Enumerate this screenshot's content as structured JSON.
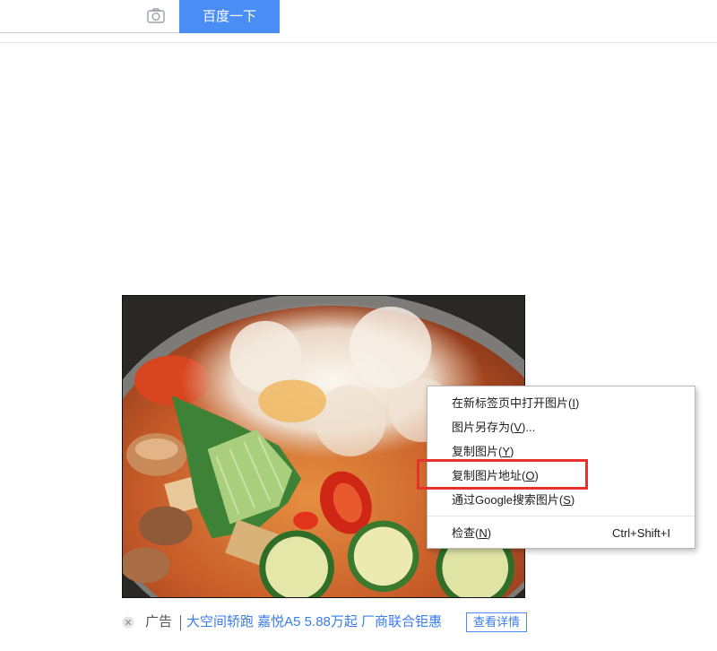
{
  "search": {
    "button_label": "百度一下",
    "camera_icon": "camera-icon"
  },
  "context_menu": {
    "items": [
      {
        "label": "在新标签页中打开图片(I)"
      },
      {
        "label": "图片另存为(V)..."
      },
      {
        "label": "复制图片(Y)"
      },
      {
        "label": "复制图片地址(O)",
        "highlighted": true
      },
      {
        "label": "通过Google搜索图片(S)"
      },
      {
        "label": "检查(N)",
        "shortcut": "Ctrl+Shift+I"
      }
    ]
  },
  "ad": {
    "close_icon": "close-circle-icon",
    "tag": "广告",
    "link_text": "大空间轿跑 嘉悦A5 5.88万起 厂商联合钜惠",
    "detail_button": "查看详情"
  },
  "colors": {
    "button_blue": "#4a8ef5",
    "highlight_red": "#e8302d",
    "link_blue": "#3b7de8"
  }
}
